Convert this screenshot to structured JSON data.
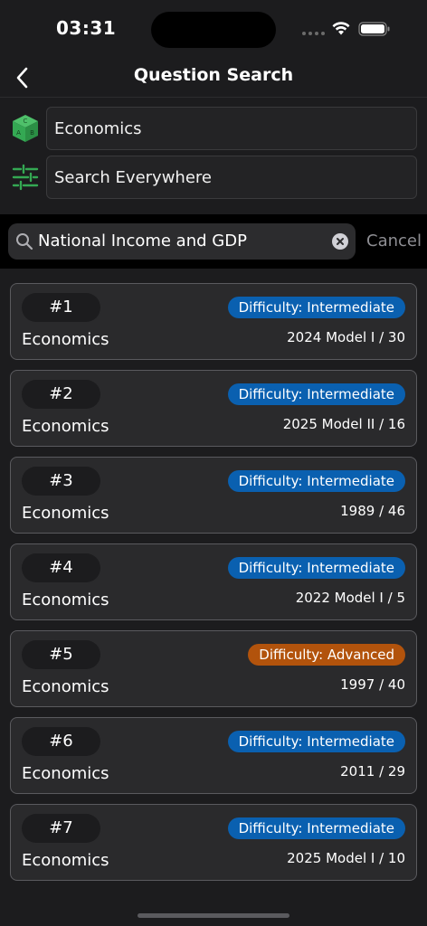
{
  "status_bar": {
    "time": "03:31"
  },
  "nav": {
    "title": "Question Search"
  },
  "filters": {
    "subject": "Economics",
    "scope": "Search Everywhere"
  },
  "search": {
    "query": "National Income and GDP",
    "cancel_label": "Cancel"
  },
  "colors": {
    "intermediate": "#0a60b0",
    "advanced": "#b2530c",
    "accent_green": "#34a853"
  },
  "questions": [
    {
      "number": "#1",
      "subject": "Economics",
      "difficulty": "Difficulty: Intermediate",
      "level": "intermediate",
      "source": "2024 Model I / 30"
    },
    {
      "number": "#2",
      "subject": "Economics",
      "difficulty": "Difficulty: Intermediate",
      "level": "intermediate",
      "source": "2025 Model II / 16"
    },
    {
      "number": "#3",
      "subject": "Economics",
      "difficulty": "Difficulty: Intermediate",
      "level": "intermediate",
      "source": "1989 / 46"
    },
    {
      "number": "#4",
      "subject": "Economics",
      "difficulty": "Difficulty: Intermediate",
      "level": "intermediate",
      "source": "2022 Model I / 5"
    },
    {
      "number": "#5",
      "subject": "Economics",
      "difficulty": "Difficulty: Advanced",
      "level": "advanced",
      "source": "1997 / 40"
    },
    {
      "number": "#6",
      "subject": "Economics",
      "difficulty": "Difficulty: Intermediate",
      "level": "intermediate",
      "source": "2011 / 29"
    },
    {
      "number": "#7",
      "subject": "Economics",
      "difficulty": "Difficulty: Intermediate",
      "level": "intermediate",
      "source": "2025 Model I / 10"
    }
  ]
}
